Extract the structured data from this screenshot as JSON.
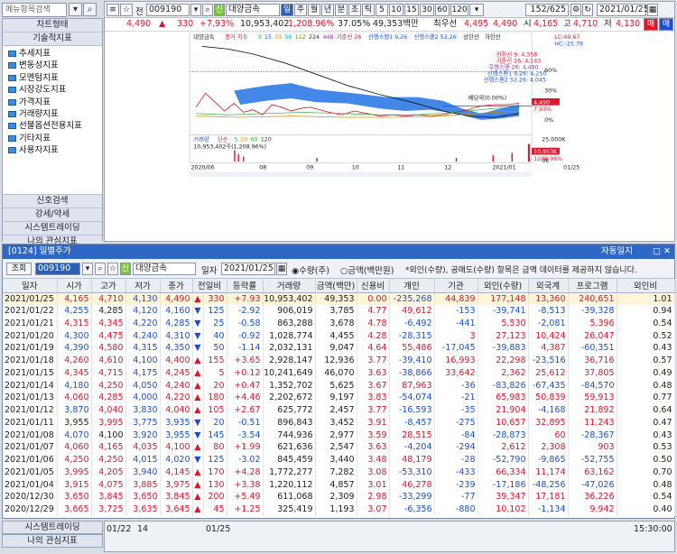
{
  "topbar": {
    "search_placeholder": "메뉴항목검색"
  },
  "chart_window": {
    "code": "009190",
    "prefix": "전",
    "stock_name": "대양금속",
    "period_buttons": [
      "일",
      "주",
      "월",
      "년",
      "분",
      "초",
      "틱"
    ],
    "active_period": "일",
    "intervals": [
      "5",
      "10",
      "15",
      "30",
      "60",
      "120"
    ],
    "page_counter": "152/625",
    "date": "2021/01/25",
    "quote": {
      "price": "4,490",
      "change": "330",
      "rate": "+7.93%",
      "volume": "10,953,402",
      "vol_rate": "1,208.96%",
      "turnover": "37.05%",
      "amount": "49,353백만",
      "open_label": "최우선",
      "open": "4,495",
      "sell": "4,490",
      "high_label": "시",
      "high": "4,165",
      "high2_label": "고",
      "high2": "4,710",
      "low_label": "저",
      "low": "4,130"
    },
    "legend": [
      "대양금속",
      "종가 지수",
      "5",
      "15",
      "33",
      "56",
      "112",
      "224",
      "448",
      "기준선 26",
      "선행스팬1 9,26",
      "선행스팬2 52,26",
      "상한선",
      "하한선"
    ],
    "right_info": [
      "LC:49.67",
      "HC:-25.79"
    ],
    "y_ticks": [
      "60%",
      "30%",
      "0%",
      "-25%"
    ],
    "ichimoku_labels": [
      "전환선 9: 4,358",
      "기준선 26: 4,143",
      "후행스팬 26: 4,490",
      "선행스팬1 9,26: 4,250",
      "선행스팬2 52,26: 4,045"
    ],
    "bae_label": "배당락(0.00%)",
    "price_tag": "4,490",
    "rate_tag": "7.93%",
    "vol_legend": [
      "거래량",
      "단순",
      "5",
      "20",
      "60",
      "120"
    ],
    "vol_info": "10,953,402주(1,208.96%)",
    "vol_ticks": [
      "25,000K",
      "0K"
    ],
    "vol_tag": [
      "10,953K",
      "1208.96%"
    ],
    "x_labels": [
      "2020/06",
      "08",
      "09",
      "10",
      "11",
      "12",
      "2021/01",
      "01/25"
    ],
    "buy_sell": [
      "매수",
      "매도"
    ]
  },
  "left_panel": {
    "head": "차트형태",
    "head2": "기술적지표",
    "items": [
      "추세지표",
      "변동성지표",
      "모멘텀지표",
      "시장강도지표",
      "가격지표",
      "거래량지표",
      "선물옵션전용지표",
      "기타지표",
      "사용자지표"
    ],
    "buttons": [
      "신호검색",
      "강세/약세",
      "시스템트레이딩",
      "나의 관심지표"
    ]
  },
  "chart_data": {
    "type": "line",
    "title": "대양금속",
    "x": [
      "2020/06",
      "08",
      "09",
      "10",
      "11",
      "12",
      "2021/01",
      "01/25"
    ],
    "series": [
      {
        "name": "종가 지수",
        "values": [
          0,
          8,
          12,
          5,
          -2,
          4,
          10,
          18
        ]
      },
      {
        "name": "448",
        "values": [
          45,
          30,
          18,
          10,
          5,
          0,
          -2,
          -1
        ]
      }
    ],
    "ylim": [
      -25,
      60
    ]
  },
  "grid": {
    "title": "[0124] 일별주가",
    "help": "자동일지",
    "query_label": "조회",
    "code": "009190",
    "name": "대양금속",
    "date_label": "일자",
    "date": "2021/01/25",
    "radio1": "수량(주)",
    "radio2": "금액(백만원)",
    "note": "*외인(수량), 공매도(수량) 항목은 금액 데이터를 제공하지 않습니다.",
    "columns": [
      "일자",
      "시가",
      "고가",
      "저가",
      "종가",
      "전일비",
      "등락률",
      "거래량",
      "금액(백만)",
      "신용비",
      "개인",
      "기관",
      "외인(수량)",
      "외국계",
      "프로그램",
      "외인비"
    ],
    "rows": [
      [
        "2021/01/25",
        "4,165",
        "4,710",
        "4,130",
        "4,490",
        "▲",
        "330",
        "+7.93",
        "10,953,402",
        "49,353",
        "0.00",
        "-235,268",
        "44,839",
        "177,148",
        "13,360",
        "240,651",
        "1.01"
      ],
      [
        "2021/01/22",
        "4,255",
        "4,285",
        "4,120",
        "4,160",
        "▼",
        "125",
        "-2.92",
        "906,019",
        "3,785",
        "4.77",
        "49,612",
        "-153",
        "-39,741",
        "-8,513",
        "-39,328",
        "0.94"
      ],
      [
        "2021/01/21",
        "4,315",
        "4,345",
        "4,220",
        "4,285",
        "▼",
        "25",
        "-0.58",
        "863,288",
        "3,678",
        "4.78",
        "-6,492",
        "-441",
        "5,530",
        "-2,081",
        "5,396",
        "0.54"
      ],
      [
        "2021/01/20",
        "4,300",
        "4,475",
        "4,240",
        "4,310",
        "▼",
        "40",
        "-0.92",
        "1,028,774",
        "4,455",
        "4.28",
        "-28,315",
        "3",
        "27,123",
        "10,424",
        "26,047",
        "0.52"
      ],
      [
        "2021/01/19",
        "4,390",
        "4,580",
        "4,315",
        "4,350",
        "▼",
        "50",
        "-1.14",
        "2,032,131",
        "9,047",
        "4.64",
        "55,486",
        "-17,045",
        "-39,883",
        "4,387",
        "-60,351",
        "0.43"
      ],
      [
        "2021/01/18",
        "4,260",
        "4,610",
        "4,100",
        "4,400",
        "▲",
        "155",
        "+3.65",
        "2,928,147",
        "12,936",
        "3.77",
        "-39,410",
        "16,993",
        "22,298",
        "-23,516",
        "36,716",
        "0.57"
      ],
      [
        "2021/01/15",
        "4,345",
        "4,715",
        "4,175",
        "4,245",
        "▲",
        "5",
        "+0.12",
        "10,241,649",
        "46,070",
        "3.63",
        "-38,866",
        "33,642",
        "2,362",
        "25,612",
        "37,805",
        "0.49"
      ],
      [
        "2021/01/14",
        "4,180",
        "4,250",
        "4,050",
        "4,240",
        "▲",
        "20",
        "+0.47",
        "1,352,702",
        "5,625",
        "3.67",
        "87,963",
        "-36",
        "-83,826",
        "-67,435",
        "-84,570",
        "0.48"
      ],
      [
        "2021/01/13",
        "4,060",
        "4,285",
        "4,000",
        "4,220",
        "▲",
        "180",
        "+4.46",
        "2,202,672",
        "9,197",
        "3.83",
        "-54,074",
        "-21",
        "65,983",
        "50,839",
        "59,913",
        "0.77"
      ],
      [
        "2021/01/12",
        "3,870",
        "4,040",
        "3,830",
        "4,040",
        "▲",
        "105",
        "+2.67",
        "625,772",
        "2,457",
        "3.77",
        "-16,593",
        "-35",
        "21,904",
        "-4,168",
        "21,892",
        "0.64"
      ],
      [
        "2021/01/11",
        "3,955",
        "3,995",
        "3,775",
        "3,935",
        "▼",
        "20",
        "-0.51",
        "896,843",
        "3,452",
        "3.91",
        "-8,457",
        "-275",
        "10,657",
        "32,895",
        "11,243",
        "0.47"
      ],
      [
        "2021/01/08",
        "4,070",
        "4,100",
        "3,920",
        "3,955",
        "▼",
        "145",
        "-3.54",
        "744,936",
        "2,977",
        "3.59",
        "28,515",
        "-84",
        "-28,873",
        "60",
        "-28,367",
        "0.43"
      ],
      [
        "2021/01/07",
        "4,060",
        "4,165",
        "4,035",
        "4,100",
        "▲",
        "80",
        "+1.99",
        "621,636",
        "2,547",
        "3.63",
        "-4,204",
        "-294",
        "2,612",
        "2,308",
        "903",
        "0.53"
      ],
      [
        "2021/01/06",
        "4,250",
        "4,250",
        "4,015",
        "4,020",
        "▼",
        "125",
        "-3.02",
        "845,459",
        "3,440",
        "3.48",
        "48,179",
        "-28",
        "-52,790",
        "-9,865",
        "-52,755",
        "0.50"
      ],
      [
        "2021/01/05",
        "3,995",
        "4,205",
        "3,940",
        "4,145",
        "▲",
        "170",
        "+4.28",
        "1,772,277",
        "7,282",
        "3.08",
        "-53,310",
        "-433",
        "66,334",
        "11,174",
        "63,162",
        "0.70"
      ],
      [
        "2021/01/04",
        "3,915",
        "4,075",
        "3,885",
        "3,975",
        "▲",
        "130",
        "+3.38",
        "1,220,112",
        "4,857",
        "3.01",
        "46,278",
        "-239",
        "-17,186",
        "-48,256",
        "-47,026",
        "0.48"
      ],
      [
        "2020/12/30",
        "3,650",
        "3,845",
        "3,650",
        "3,845",
        "▲",
        "200",
        "+5.49",
        "611,068",
        "2,309",
        "2.98",
        "-33,299",
        "-77",
        "39,347",
        "17,181",
        "36,226",
        "0.54"
      ],
      [
        "2020/12/29",
        "3,665",
        "3,725",
        "3,635",
        "3,645",
        "▲",
        "45",
        "+1.25",
        "325,419",
        "1,193",
        "3.07",
        "-6,356",
        "-880",
        "10,102",
        "-1,134",
        "9,942",
        "0.40"
      ]
    ]
  },
  "bottom": {
    "left_buttons": [
      "시스템트레이딩",
      "나의 관심지표"
    ],
    "x_labels": [
      "01/22",
      "14",
      "01/25"
    ],
    "time": "15:30:00"
  }
}
